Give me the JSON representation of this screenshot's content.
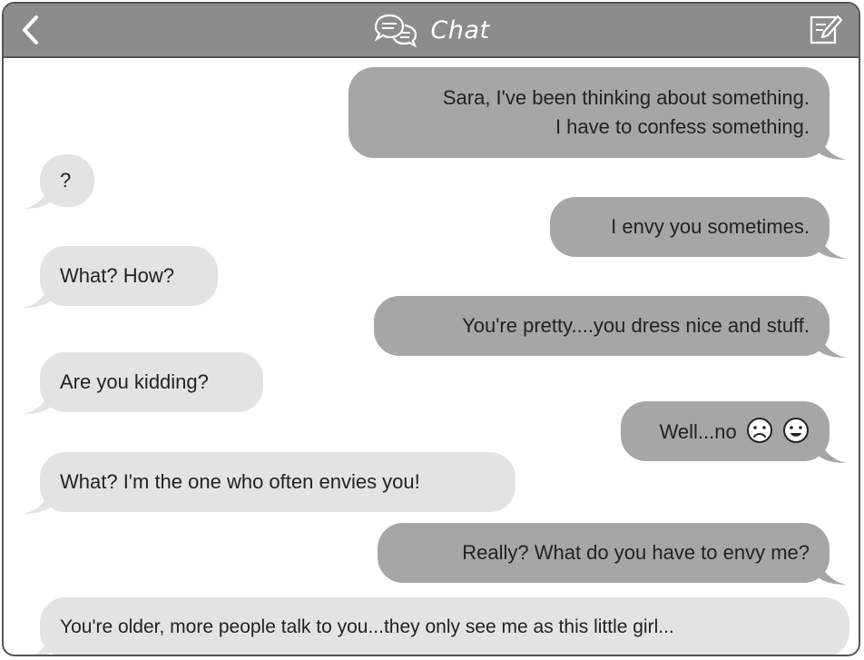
{
  "header": {
    "title": "Chat",
    "back_icon": "chevron-left-icon",
    "title_icon": "speech-bubbles-icon",
    "compose_icon": "compose-icon",
    "bar_color": "#8c8c8c"
  },
  "colors": {
    "sent_bubble": "#a6a6a6",
    "received_bubble": "#e3e3e3",
    "text": "#222222"
  },
  "messages": [
    {
      "side": "sent",
      "lines": [
        "Sara, I've been thinking about something.",
        "I have to confess something."
      ]
    },
    {
      "side": "received",
      "lines": [
        "?"
      ]
    },
    {
      "side": "sent",
      "lines": [
        "I envy you sometimes."
      ]
    },
    {
      "side": "received",
      "lines": [
        "What? How?"
      ]
    },
    {
      "side": "sent",
      "lines": [
        "You're pretty....you dress nice and stuff."
      ]
    },
    {
      "side": "received",
      "lines": [
        "Are you kidding?"
      ]
    },
    {
      "side": "sent",
      "lines": [
        "Well...no"
      ],
      "emojis": [
        "sad-face-icon",
        "grimace-face-icon"
      ]
    },
    {
      "side": "received",
      "lines": [
        "What? I'm the one who often envies you!"
      ]
    },
    {
      "side": "sent",
      "lines": [
        "Really? What do you have to envy me?"
      ]
    },
    {
      "side": "received",
      "lines": [
        "You're older, more people talk to you...they only see me as this little girl..."
      ]
    }
  ]
}
